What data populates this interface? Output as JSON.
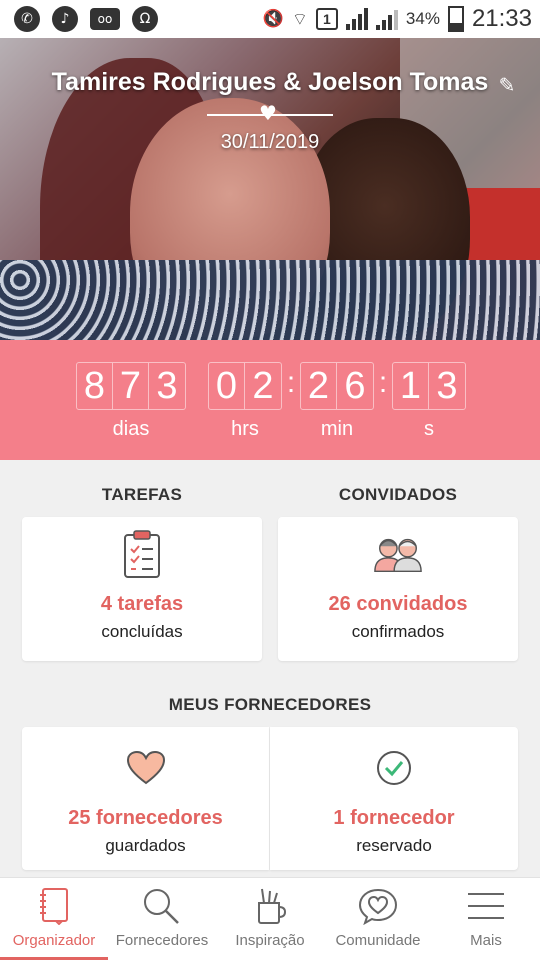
{
  "status_bar": {
    "battery": "34%",
    "time": "21:33",
    "sim_label": "1",
    "left_icons": [
      "whatsapp-icon",
      "music-icon",
      "voicemail-icon",
      "headset-icon"
    ]
  },
  "hero": {
    "title": "Tamires Rodrigues & Joelson Tomas",
    "date": "30/11/2019"
  },
  "countdown": {
    "groups": [
      {
        "digits": [
          "8",
          "7",
          "3"
        ],
        "label": "dias"
      },
      {
        "digits": [
          "0",
          "2"
        ],
        "label": "hrs"
      },
      {
        "digits": [
          "2",
          "6"
        ],
        "label": "min"
      },
      {
        "digits": [
          "1",
          "3"
        ],
        "label": "s"
      }
    ]
  },
  "tarefas": {
    "title": "TAREFAS",
    "value": "4 tarefas",
    "sub": "concluídas",
    "icon": "clipboard-icon"
  },
  "convidados": {
    "title": "CONVIDADOS",
    "value": "26 convidados",
    "sub": "confirmados",
    "icon": "guests-icon"
  },
  "fornecedores": {
    "title": "MEUS FORNECEDORES",
    "saved": {
      "value": "25 fornecedores",
      "sub": "guardados",
      "icon": "heart-icon"
    },
    "reserved": {
      "value": "1 fornecedor",
      "sub": "reservado",
      "icon": "check-circle-icon"
    }
  },
  "nav": {
    "items": [
      {
        "label": "Organizador",
        "icon": "notebook-icon",
        "active": true
      },
      {
        "label": "Fornecedores",
        "icon": "search-icon"
      },
      {
        "label": "Inspiração",
        "icon": "brushes-icon"
      },
      {
        "label": "Comunidade",
        "icon": "chat-heart-icon"
      },
      {
        "label": "Mais",
        "icon": "menu-icon"
      }
    ]
  },
  "colors": {
    "accent": "#e26461",
    "countdown_bg": "#f47f8a"
  }
}
